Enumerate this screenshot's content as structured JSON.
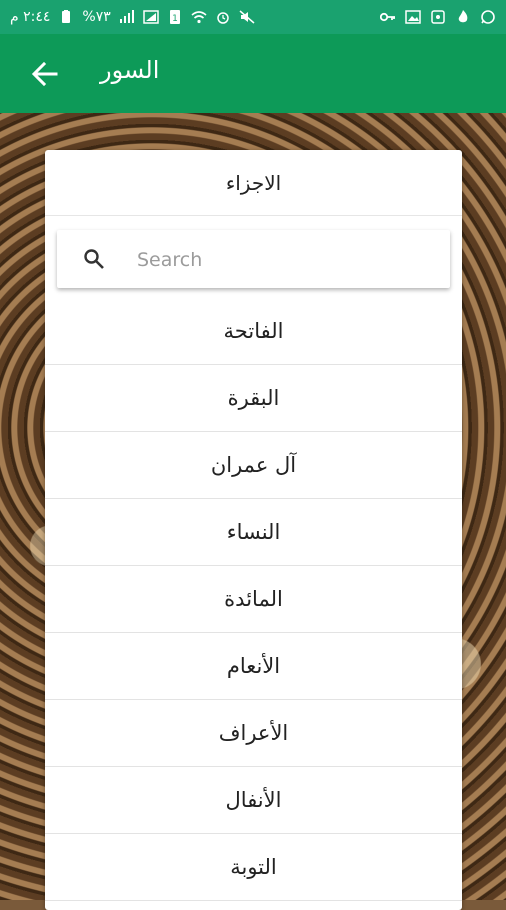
{
  "status_bar": {
    "time": "٢:٤٤ م",
    "battery": "%٧٣"
  },
  "app_bar": {
    "title": "السور"
  },
  "header": {
    "label": "الاجزاء"
  },
  "search": {
    "placeholder": "Search",
    "value": ""
  },
  "surahs": [
    "الفاتحة",
    "البقرة",
    "آل عمران",
    "النساء",
    "المائدة",
    "الأنعام",
    "الأعراف",
    "الأنفال",
    "التوبة"
  ],
  "colors": {
    "status_bar": "#1aa26f",
    "app_bar": "#0d9a58"
  }
}
